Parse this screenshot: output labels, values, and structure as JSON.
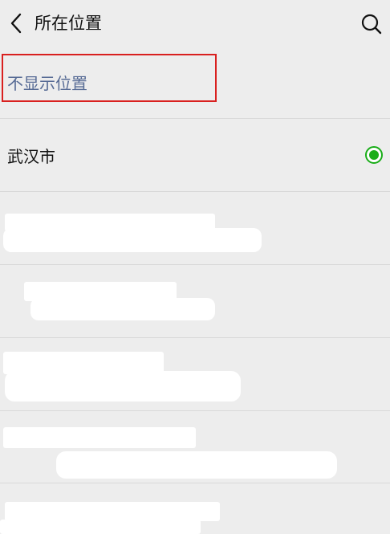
{
  "header": {
    "title": "所在位置"
  },
  "options": {
    "hide_location": "不显示位置",
    "city": "武汉市",
    "city_selected": true
  },
  "colors": {
    "link": "#576b95",
    "selected": "#1aad19",
    "highlight_border": "#d9201f"
  },
  "icons": {
    "back": "chevron-left-icon",
    "search": "search-icon",
    "selected": "radio-checked-icon"
  }
}
